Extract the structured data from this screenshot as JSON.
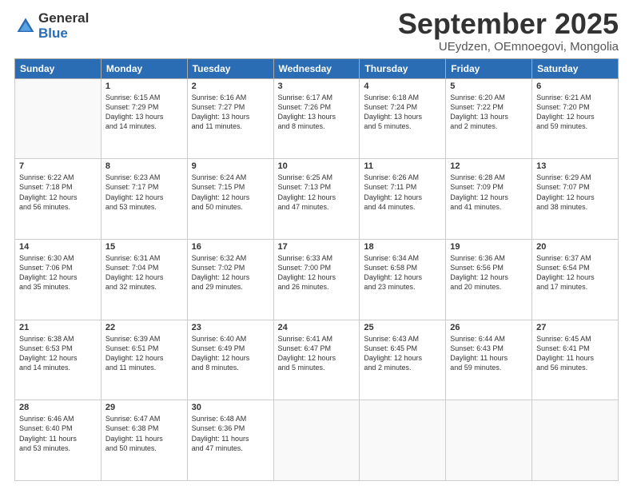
{
  "logo": {
    "general": "General",
    "blue": "Blue"
  },
  "title": "September 2025",
  "subtitle": "UEydzen, OEmnoegovi, Mongolia",
  "days_of_week": [
    "Sunday",
    "Monday",
    "Tuesday",
    "Wednesday",
    "Thursday",
    "Friday",
    "Saturday"
  ],
  "weeks": [
    [
      {
        "day": "",
        "info": ""
      },
      {
        "day": "1",
        "info": "Sunrise: 6:15 AM\nSunset: 7:29 PM\nDaylight: 13 hours\nand 14 minutes."
      },
      {
        "day": "2",
        "info": "Sunrise: 6:16 AM\nSunset: 7:27 PM\nDaylight: 13 hours\nand 11 minutes."
      },
      {
        "day": "3",
        "info": "Sunrise: 6:17 AM\nSunset: 7:26 PM\nDaylight: 13 hours\nand 8 minutes."
      },
      {
        "day": "4",
        "info": "Sunrise: 6:18 AM\nSunset: 7:24 PM\nDaylight: 13 hours\nand 5 minutes."
      },
      {
        "day": "5",
        "info": "Sunrise: 6:20 AM\nSunset: 7:22 PM\nDaylight: 13 hours\nand 2 minutes."
      },
      {
        "day": "6",
        "info": "Sunrise: 6:21 AM\nSunset: 7:20 PM\nDaylight: 12 hours\nand 59 minutes."
      }
    ],
    [
      {
        "day": "7",
        "info": "Sunrise: 6:22 AM\nSunset: 7:18 PM\nDaylight: 12 hours\nand 56 minutes."
      },
      {
        "day": "8",
        "info": "Sunrise: 6:23 AM\nSunset: 7:17 PM\nDaylight: 12 hours\nand 53 minutes."
      },
      {
        "day": "9",
        "info": "Sunrise: 6:24 AM\nSunset: 7:15 PM\nDaylight: 12 hours\nand 50 minutes."
      },
      {
        "day": "10",
        "info": "Sunrise: 6:25 AM\nSunset: 7:13 PM\nDaylight: 12 hours\nand 47 minutes."
      },
      {
        "day": "11",
        "info": "Sunrise: 6:26 AM\nSunset: 7:11 PM\nDaylight: 12 hours\nand 44 minutes."
      },
      {
        "day": "12",
        "info": "Sunrise: 6:28 AM\nSunset: 7:09 PM\nDaylight: 12 hours\nand 41 minutes."
      },
      {
        "day": "13",
        "info": "Sunrise: 6:29 AM\nSunset: 7:07 PM\nDaylight: 12 hours\nand 38 minutes."
      }
    ],
    [
      {
        "day": "14",
        "info": "Sunrise: 6:30 AM\nSunset: 7:06 PM\nDaylight: 12 hours\nand 35 minutes."
      },
      {
        "day": "15",
        "info": "Sunrise: 6:31 AM\nSunset: 7:04 PM\nDaylight: 12 hours\nand 32 minutes."
      },
      {
        "day": "16",
        "info": "Sunrise: 6:32 AM\nSunset: 7:02 PM\nDaylight: 12 hours\nand 29 minutes."
      },
      {
        "day": "17",
        "info": "Sunrise: 6:33 AM\nSunset: 7:00 PM\nDaylight: 12 hours\nand 26 minutes."
      },
      {
        "day": "18",
        "info": "Sunrise: 6:34 AM\nSunset: 6:58 PM\nDaylight: 12 hours\nand 23 minutes."
      },
      {
        "day": "19",
        "info": "Sunrise: 6:36 AM\nSunset: 6:56 PM\nDaylight: 12 hours\nand 20 minutes."
      },
      {
        "day": "20",
        "info": "Sunrise: 6:37 AM\nSunset: 6:54 PM\nDaylight: 12 hours\nand 17 minutes."
      }
    ],
    [
      {
        "day": "21",
        "info": "Sunrise: 6:38 AM\nSunset: 6:53 PM\nDaylight: 12 hours\nand 14 minutes."
      },
      {
        "day": "22",
        "info": "Sunrise: 6:39 AM\nSunset: 6:51 PM\nDaylight: 12 hours\nand 11 minutes."
      },
      {
        "day": "23",
        "info": "Sunrise: 6:40 AM\nSunset: 6:49 PM\nDaylight: 12 hours\nand 8 minutes."
      },
      {
        "day": "24",
        "info": "Sunrise: 6:41 AM\nSunset: 6:47 PM\nDaylight: 12 hours\nand 5 minutes."
      },
      {
        "day": "25",
        "info": "Sunrise: 6:43 AM\nSunset: 6:45 PM\nDaylight: 12 hours\nand 2 minutes."
      },
      {
        "day": "26",
        "info": "Sunrise: 6:44 AM\nSunset: 6:43 PM\nDaylight: 11 hours\nand 59 minutes."
      },
      {
        "day": "27",
        "info": "Sunrise: 6:45 AM\nSunset: 6:41 PM\nDaylight: 11 hours\nand 56 minutes."
      }
    ],
    [
      {
        "day": "28",
        "info": "Sunrise: 6:46 AM\nSunset: 6:40 PM\nDaylight: 11 hours\nand 53 minutes."
      },
      {
        "day": "29",
        "info": "Sunrise: 6:47 AM\nSunset: 6:38 PM\nDaylight: 11 hours\nand 50 minutes."
      },
      {
        "day": "30",
        "info": "Sunrise: 6:48 AM\nSunset: 6:36 PM\nDaylight: 11 hours\nand 47 minutes."
      },
      {
        "day": "",
        "info": ""
      },
      {
        "day": "",
        "info": ""
      },
      {
        "day": "",
        "info": ""
      },
      {
        "day": "",
        "info": ""
      }
    ]
  ]
}
